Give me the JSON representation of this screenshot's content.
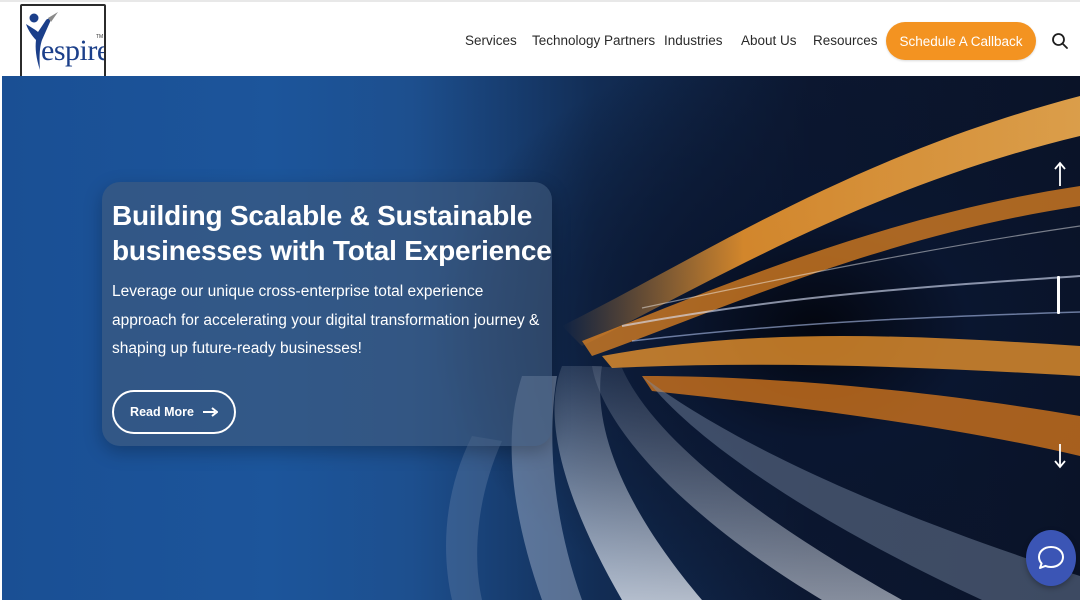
{
  "header": {
    "logo_text": "espire",
    "logo_tm": "TM",
    "nav": [
      {
        "label": "Services"
      },
      {
        "label": "Technology Partners"
      },
      {
        "label": "Industries"
      },
      {
        "label": "About Us"
      },
      {
        "label": "Resources"
      }
    ],
    "cta_label": "Schedule A Callback",
    "search_icon": "search-icon"
  },
  "hero": {
    "title": "Building Scalable & Sustainable businesses with Total Experience",
    "description": "Leverage our unique cross-enterprise total experience approach for accelerating your digital transformation journey & shaping up future-ready businesses!",
    "button_label": "Read More",
    "button_icon": "arrow-right-icon"
  },
  "colors": {
    "accent": "#f39321",
    "brand_blue": "#1b3f8a",
    "chat_blue": "#3b55b5"
  },
  "icons": {
    "scroll_up": "arrow-up-icon",
    "scroll_down": "arrow-down-icon",
    "chat": "chat-bubble-icon"
  }
}
